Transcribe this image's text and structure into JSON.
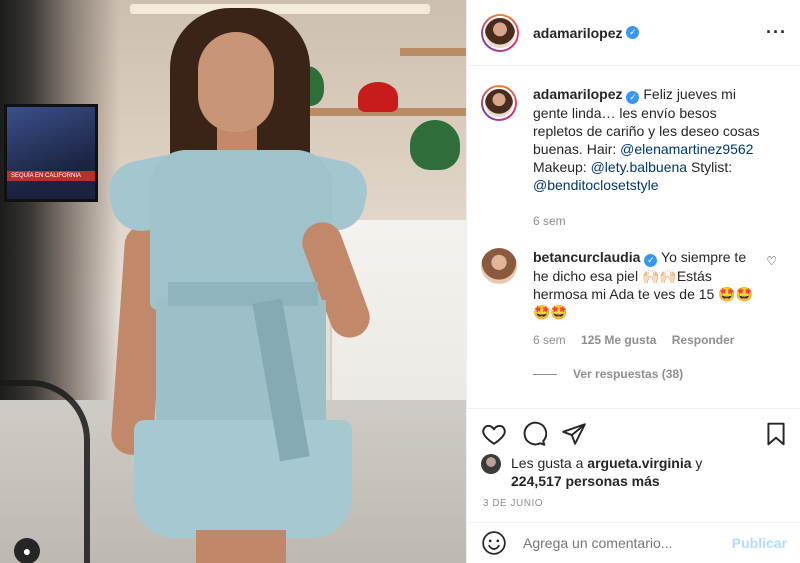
{
  "post": {
    "username": "adamarilopez",
    "more_icon": "more-horizontal-icon"
  },
  "caption": {
    "username": "adamarilopez",
    "text_before": "Feliz jueves mi gente linda… les envío besos repletos de cariño y les deseo cosas buenas. Hair: ",
    "mention_hair": "@elenamartinez9562",
    "text_makeup": " Makeup: ",
    "mention_makeup": "@lety.balbuena",
    "text_stylist": " Stylist: ",
    "mention_stylist": "@benditoclosetstyle",
    "time": "6 sem"
  },
  "comment": {
    "username": "betancurclaudia",
    "text": "Yo siempre te he dicho esa piel 🙌🏻🙌🏻Estás hermosa mi Ada te ves de 15 🤩🤩🤩🤩",
    "time": "6 sem",
    "likes": "125 Me gusta",
    "reply": "Responder",
    "view_replies": "Ver respuestas (38)"
  },
  "likes": {
    "prefix": "Les gusta a ",
    "user": "argueta.virginia",
    "middle": " y",
    "count": "224,517 personas más"
  },
  "date": "3 DE JUNIO",
  "add_comment": {
    "placeholder": "Agrega un comentario...",
    "post_label": "Publicar"
  },
  "photo": {
    "monitor_ticker": "SEQUÍA EN CALIFORNIA"
  },
  "colors": {
    "verified": "#3897f0",
    "mention": "#00376b",
    "publish_disabled": "#b3dbff"
  }
}
